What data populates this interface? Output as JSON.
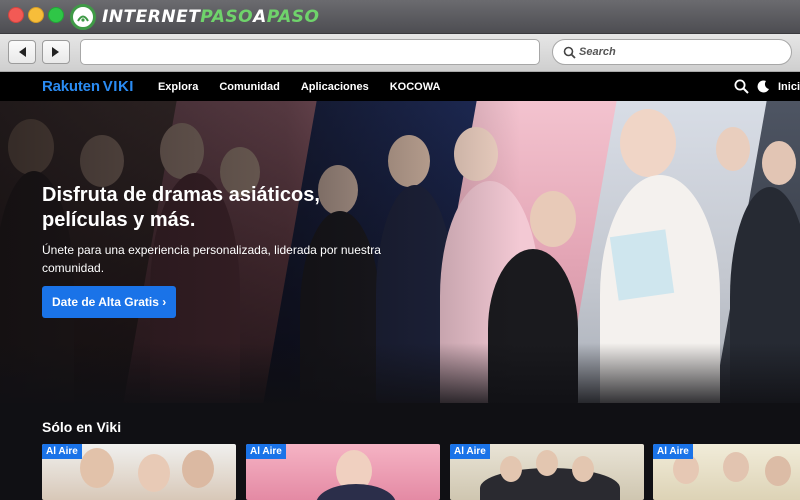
{
  "watermark": {
    "brand_left": "INTERNET",
    "brand_accent": "PASO",
    "brand_mid": "A",
    "brand_right": "PASO"
  },
  "browser": {
    "address_value": "",
    "search_placeholder": "Search"
  },
  "viki": {
    "logo_rakuten": "Rakuten",
    "logo_viki": "VIKI",
    "nav": [
      "Explora",
      "Comunidad",
      "Aplicaciones",
      "KOCOWA"
    ],
    "cut_label": "Inicia"
  },
  "hero": {
    "title": "Disfruta de dramas asiáticos, películas y más.",
    "subtitle": "Únete para una experiencia personalizada, liderada por nuestra comunidad.",
    "cta": "Date de Alta Gratis ›"
  },
  "section": {
    "title": "Sólo en Viki",
    "cards": [
      {
        "badge": "Al Aire"
      },
      {
        "badge": "Al Aire"
      },
      {
        "badge": "Al Aire"
      },
      {
        "badge": "Al Aire"
      }
    ]
  },
  "colors": {
    "accent": "#1a73e8",
    "viki_blue": "#2a8bf2",
    "header_bg": "#000000"
  }
}
